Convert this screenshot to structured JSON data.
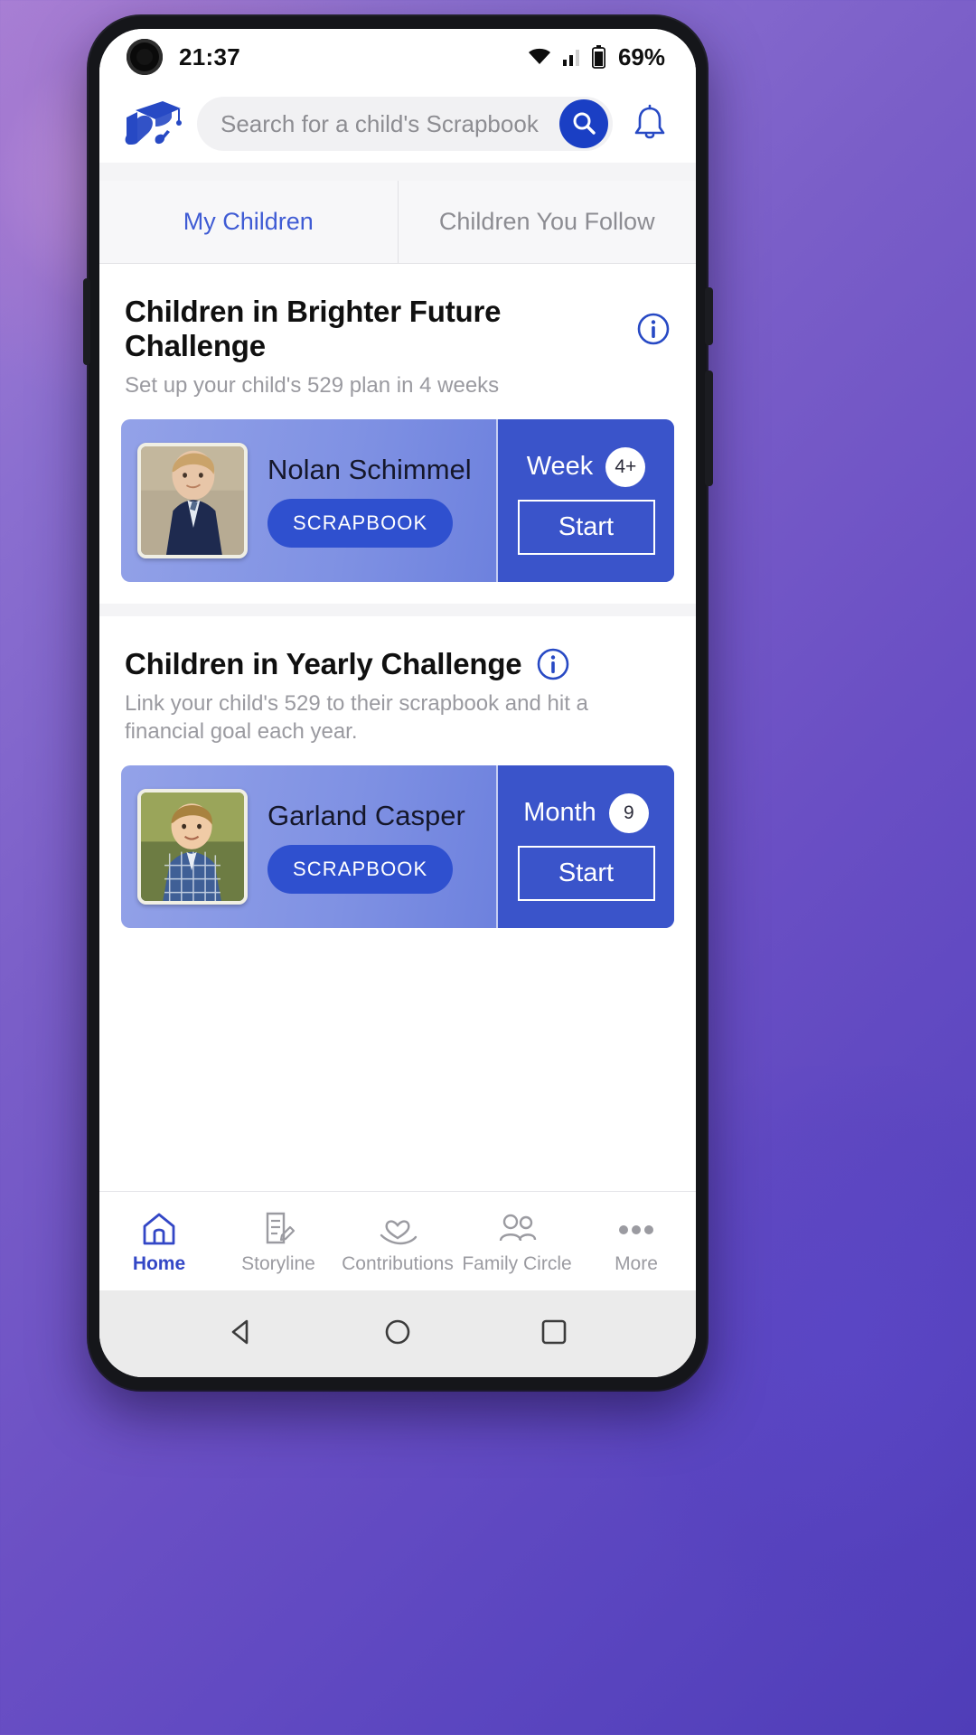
{
  "status_bar": {
    "time": "21:37",
    "battery_percent": "69%",
    "icons": [
      "wifi-icon",
      "cellular-signal-icon",
      "battery-icon"
    ]
  },
  "app_bar": {
    "logo_name": "dreamkidz-graduation-cap-logo",
    "search": {
      "placeholder": "Search for a child's Scrapbook",
      "value": ""
    },
    "search_button_icon": "search-icon",
    "notification_icon": "bell-icon"
  },
  "tabs": [
    {
      "label": "My Children",
      "active": true
    },
    {
      "label": "Children You Follow",
      "active": false
    }
  ],
  "sections": [
    {
      "title": "Children in Brighter Future Challenge",
      "subtitle": "Set up your child's 529 plan in 4 weeks",
      "info_icon": "info-circle-icon",
      "child": {
        "name": "Nolan Schimmel",
        "scrapbook_label": "SCRAPBOOK",
        "period_label": "Week",
        "period_badge": "4+",
        "action_label": "Start",
        "avatar_name": "child-photo-nolan"
      }
    },
    {
      "title": "Children in Yearly Challenge",
      "subtitle": "Link your child's 529 to their scrapbook and hit a financial goal each year.",
      "info_icon": "info-circle-icon",
      "child": {
        "name": "Garland Casper",
        "scrapbook_label": "SCRAPBOOK",
        "period_label": "Month",
        "period_badge": "9",
        "action_label": "Start",
        "avatar_name": "child-photo-garland"
      }
    }
  ],
  "bottom_nav": [
    {
      "label": "Home",
      "icon": "home-icon",
      "active": true
    },
    {
      "label": "Storyline",
      "icon": "document-pencil-icon",
      "active": false
    },
    {
      "label": "Contributions",
      "icon": "heart-in-hand-icon",
      "active": false
    },
    {
      "label": "Family Circle",
      "icon": "people-group-icon",
      "active": false
    },
    {
      "label": "More",
      "icon": "ellipsis-icon",
      "active": false
    }
  ],
  "system_nav": [
    {
      "name": "back-button",
      "icon": "triangle-left-icon"
    },
    {
      "name": "home-button",
      "icon": "circle-icon"
    },
    {
      "name": "recents-button",
      "icon": "square-icon"
    }
  ],
  "colors": {
    "accent_blue": "#1a3fc4",
    "tab_active": "#3f5bd4",
    "card_gradient_start": "#93a2e8",
    "card_gradient_end": "#5a70d8",
    "card_right_panel": "#3a54ca"
  }
}
